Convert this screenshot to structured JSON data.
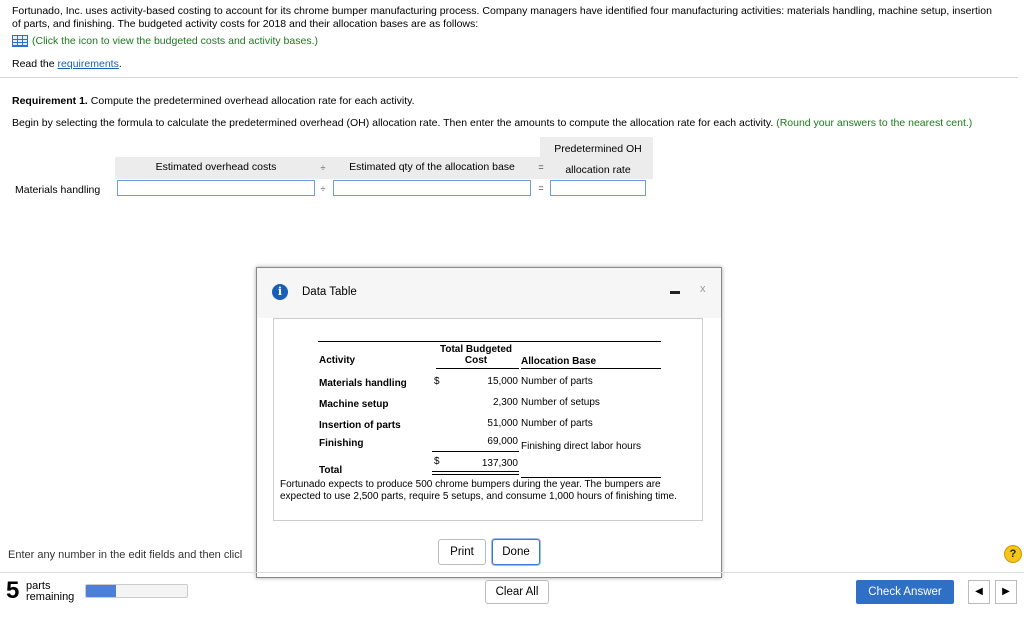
{
  "intro_text": "Fortunado, Inc. uses activity-based costing to account for its chrome bumper manufacturing process. Company managers have identified four manufacturing activities: materials handling, machine setup, insertion of parts, and finishing. The budgeted activity costs for 2018 and their allocation bases are as follows:",
  "icon_link_text": "(Click the icon to view the budgeted costs and activity bases.)",
  "read_prefix": "Read the ",
  "read_link": "requirements",
  "read_suffix": ".",
  "requirement_label": "Requirement 1.",
  "requirement_text": " Compute the predetermined overhead allocation rate for each activity.",
  "begin_text": "Begin by selecting the formula to calculate the predetermined overhead (OH) allocation rate. Then enter the amounts to compute the allocation rate for each activity. ",
  "begin_hint": "(Round your answers to the nearest cent.)",
  "formula": {
    "col1": "Estimated overhead costs",
    "op1": "÷",
    "col2": "Estimated qty of the allocation base",
    "op2": "=",
    "col3_line1": "Predetermined OH",
    "col3_line2": "allocation rate",
    "row_label": "Materials handling",
    "row_op1": "÷",
    "row_op2": "="
  },
  "modal": {
    "title": "Data Table",
    "minimize_glyph": "",
    "close_glyph": "x",
    "table": {
      "headers": {
        "activity": "Activity",
        "cost_line1": "Total Budgeted",
        "cost_line2": "Cost",
        "base": "Allocation Base"
      },
      "rows": [
        {
          "activity": "Materials handling",
          "dollar": "$",
          "cost": "15,000",
          "base": "Number of parts"
        },
        {
          "activity": "Machine setup",
          "dollar": "",
          "cost": "2,300",
          "base": "Number of setups"
        },
        {
          "activity": "Insertion of parts",
          "dollar": "",
          "cost": "51,000",
          "base": "Number of parts"
        },
        {
          "activity": "Finishing",
          "dollar": "",
          "cost": "69,000",
          "base": "Finishing direct labor hours"
        }
      ],
      "total_label": "Total",
      "total_dollar": "$",
      "total_cost": "137,300"
    },
    "note": "Fortunado expects to produce 500 chrome bumpers during the year. The bumpers are expected to use 2,500 parts, require 5 setups, and consume 1,000 hours of finishing time.",
    "print_label": "Print",
    "done_label": "Done"
  },
  "footer": {
    "enter_text": "Enter any number in the edit fields and then clicl",
    "help_glyph": "?",
    "parts_number": "5",
    "parts_word1": "parts",
    "parts_word2": "remaining",
    "progress_fraction": 0.3,
    "clear_all_label": "Clear All",
    "check_answer_label": "Check Answer",
    "prev_glyph": "◀",
    "next_glyph": "▶"
  },
  "colors": {
    "link_blue": "#1a5fb4",
    "hint_green": "#1b7a1b",
    "primary_button": "#2f6fc6",
    "input_border": "#6d9be0"
  }
}
